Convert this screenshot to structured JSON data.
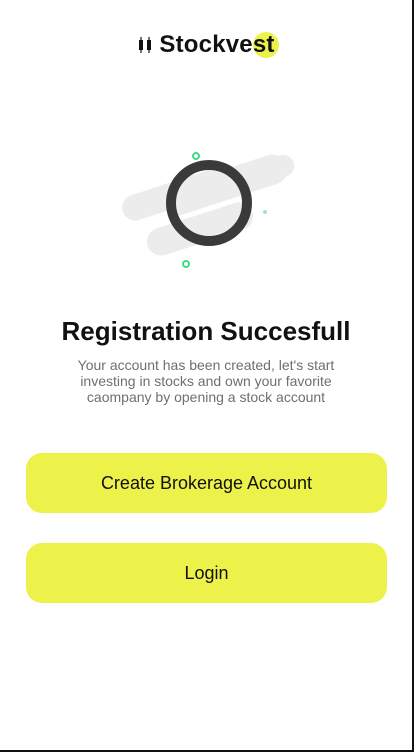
{
  "brand": {
    "name": "Stockvest",
    "accent_color": "#ecf249"
  },
  "illustration": {
    "icon": "loading-ring-icon"
  },
  "content": {
    "title": "Registration Succesfull",
    "description": "Your account has been created, let's start investing in stocks and own your favorite caompany by opening a stock account"
  },
  "actions": {
    "create_label": "Create Brokerage Account",
    "login_label": "Login"
  },
  "colors": {
    "button_bg": "#ecf249",
    "ring": "#3a3a3a",
    "accent_green": "#3ddc84"
  }
}
